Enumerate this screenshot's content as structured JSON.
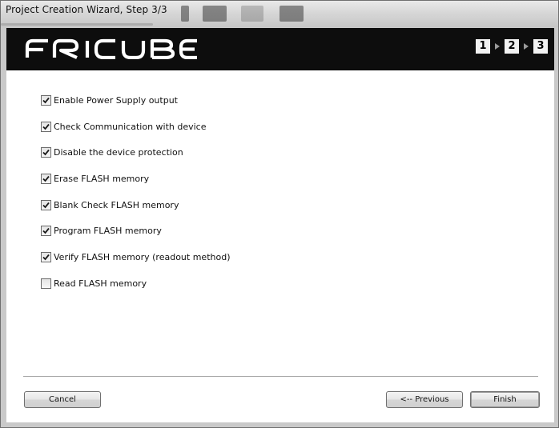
{
  "window": {
    "title": "Project Creation Wizard, Step 3/3"
  },
  "banner": {
    "logo": "FRICUBE",
    "steps": [
      "1",
      "2",
      "3"
    ],
    "accent": "#0d0d0d"
  },
  "options": [
    {
      "label": "Enable Power Supply output",
      "checked": true
    },
    {
      "label": "Check Communication with device",
      "checked": true
    },
    {
      "label": "Disable the device protection",
      "checked": true
    },
    {
      "label": "Erase FLASH memory",
      "checked": true
    },
    {
      "label": "Blank Check FLASH memory",
      "checked": true
    },
    {
      "label": "Program FLASH memory",
      "checked": true
    },
    {
      "label": "Verify FLASH memory (readout method)",
      "checked": true
    },
    {
      "label": "Read FLASH memory",
      "checked": false
    }
  ],
  "buttons": {
    "cancel": "Cancel",
    "previous": "<-- Previous",
    "finish": "Finish"
  }
}
